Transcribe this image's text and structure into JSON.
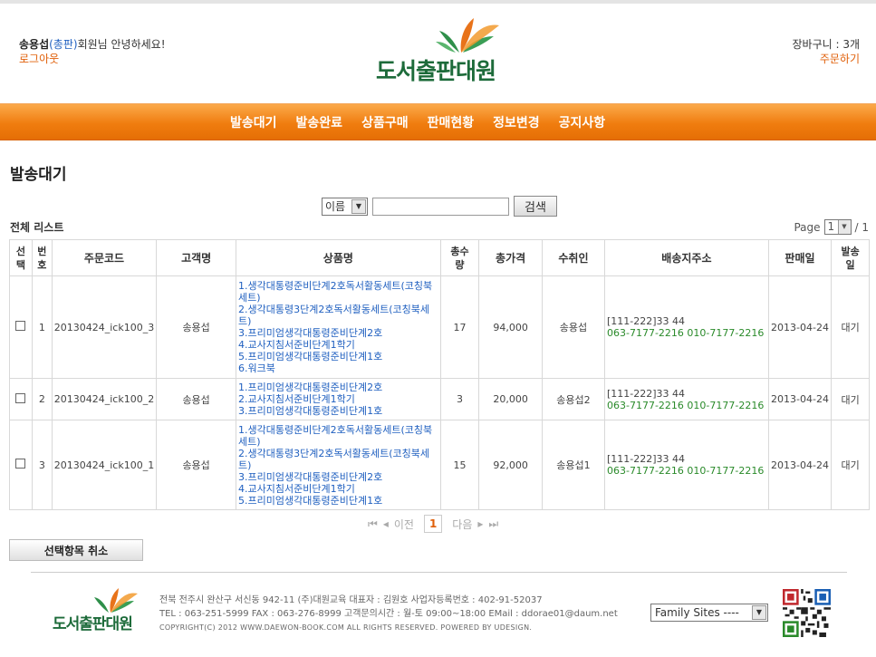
{
  "header": {
    "user_name": "송용섭",
    "user_grade": "(총판)",
    "greeting": "회원님 안녕하세요!",
    "logout": "로그아웃",
    "cart": "장바구니 : 3개",
    "order": "주문하기",
    "logo_text": "도서출판대원"
  },
  "nav": [
    "발송대기",
    "발송완료",
    "상품구매",
    "판매현황",
    "정보변경",
    "공지사항"
  ],
  "page_title": "발송대기",
  "search": {
    "field_option": "이름",
    "query": "",
    "button": "검색"
  },
  "list_label": "전체 리스트",
  "pager_top": {
    "page_label": "Page",
    "current": "1",
    "total": "/ 1"
  },
  "table": {
    "headers": [
      "선택",
      "번호",
      "주문코드",
      "고객명",
      "상품명",
      "총수량",
      "총가격",
      "수취인",
      "배송지주소",
      "판매일",
      "발송일"
    ],
    "rows": [
      {
        "no": "1",
        "code": "20130424_ick100_3",
        "customer": "송용섭",
        "products": [
          "1.생각대통령준비단계2호독서활동세트(코칭북세트)",
          "2.생각대통령3단계2호독서활동세트(코칭북세트)",
          "3.프리미엄생각대통령준비단계2호",
          "4.교사지침서준비단계1학기",
          "5.프리미엄생각대통령준비단계1호",
          "6.워크북"
        ],
        "qty": "17",
        "price": "94,000",
        "receiver": "송용섭",
        "addr": "[111-222]33 44",
        "phone": "063-7177-2216 010-7177-2216",
        "sale_date": "2013-04-24",
        "ship": "대기"
      },
      {
        "no": "2",
        "code": "20130424_ick100_2",
        "customer": "송용섭",
        "products": [
          "1.프리미엄생각대통령준비단계2호",
          "2.교사지침서준비단계1학기",
          "3.프리미엄생각대통령준비단계1호"
        ],
        "qty": "3",
        "price": "20,000",
        "receiver": "송용섭2",
        "addr": "[111-222]33 44",
        "phone": "063-7177-2216 010-7177-2216",
        "sale_date": "2013-04-24",
        "ship": "대기"
      },
      {
        "no": "3",
        "code": "20130424_ick100_1",
        "customer": "송용섭",
        "products": [
          "1.생각대통령준비단계2호독서활동세트(코칭북세트)",
          "2.생각대통령3단계2호독서활동세트(코칭북세트)",
          "3.프리미엄생각대통령준비단계2호",
          "4.교사지침서준비단계1학기",
          "5.프리미엄생각대통령준비단계1호"
        ],
        "qty": "15",
        "price": "92,000",
        "receiver": "송용섭1",
        "addr": "[111-222]33 44",
        "phone": "063-7177-2216 010-7177-2216",
        "sale_date": "2013-04-24",
        "ship": "대기"
      }
    ]
  },
  "pager_bottom": {
    "prev": "이전",
    "current": "1",
    "next": "다음"
  },
  "cancel_button": "선택항목 취소",
  "footer": {
    "logo_text": "도서출판대원",
    "line1": "전북 전주시 완산구 서신동 942-11 (주)대원교육   대표자 : 김원호   사업자등록번호 : 402-91-52037",
    "line2": "TEL : 063-251-5999   FAX : 063-276-8999   고객문의시간 : 월-토 09:00~18:00   EMail : ddorae01@daum.net",
    "copyright": "COPYRIGHT(C) 2012  WWW.DAEWON-BOOK.COM ALL RIGHTS RESERVED. POWERED BY UDESIGN.",
    "family_sites": "Family Sites ----"
  },
  "colors": {
    "accent": "#f07d0f",
    "link": "#2060c0",
    "price": "#e0600a",
    "phone": "#2a8a2a",
    "logo": "#1d6b3a"
  }
}
